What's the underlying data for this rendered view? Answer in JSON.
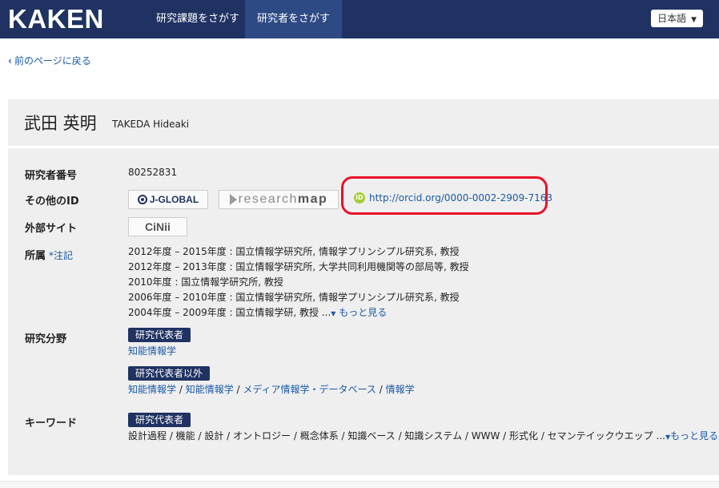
{
  "header": {
    "brand": "KAKEN",
    "tabs": [
      {
        "label": "研究課題をさがす"
      },
      {
        "label": "研究者をさがす"
      }
    ],
    "language": "日本語"
  },
  "back_link": "前のページに戻る",
  "researcher": {
    "name_ja": "武田 英明",
    "name_en": "TAKEDA Hideaki"
  },
  "labels": {
    "researcher_number": "研究者番号",
    "other_id": "その他のID",
    "external_sites": "外部サイト",
    "affiliation": "所属",
    "affiliation_note": "*注記",
    "research_field": "研究分野",
    "keywords": "キーワード"
  },
  "researcher_number": "80252831",
  "other_ids": {
    "jglobal": "J-GLOBAL",
    "researchmap_a": "research",
    "researchmap_b": "map",
    "orcid_icon": "iD",
    "orcid_url": "http://orcid.org/0000-0002-2909-7163"
  },
  "external": {
    "cinii": "CiNii"
  },
  "affiliations": [
    "2012年度 – 2015年度 : 国立情報学研究所, 情報学プリンシプル研究系, 教授",
    "2012年度 – 2013年度 : 国立情報学研究所, 大学共同利用機関等の部局等, 教授",
    "2010年度 : 国立情報学研究所, 教授",
    "2006年度 – 2010年度 : 国立情報学研究所, 情報学プリンシプル研究系, 教授",
    "2004年度 – 2009年度 : 国立情報学研, 教授 ..."
  ],
  "more_label": "もっと見る",
  "research_field": {
    "primary_badge": "研究代表者",
    "primary_fields": [
      "知能情報学"
    ],
    "other_badge": "研究代表者以外",
    "other_fields": [
      "知能情報学",
      "知能情報学",
      "メディア情報学・データベース",
      "情報学"
    ]
  },
  "keywords": {
    "badge": "研究代表者",
    "text": "設計過程 / 機能 / 設計 / オントロジー / 概念体系 / 知識ベース / 知識システム / WWW / 形式化 / セマンテイックウエップ ..."
  },
  "colors": {
    "navbar": "#1f3262",
    "active_tab": "#2e4a85",
    "link": "#1a5aa8",
    "highlight": "#e8122a",
    "orcid": "#a6ce39"
  }
}
